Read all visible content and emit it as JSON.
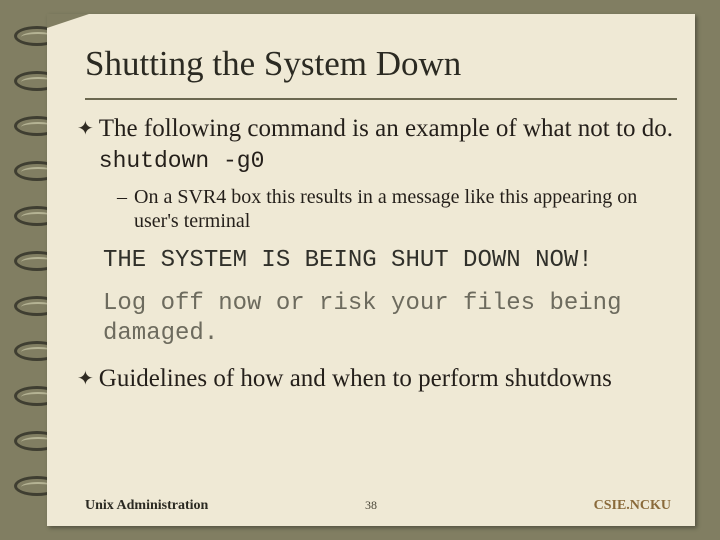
{
  "slide": {
    "title": "Shutting the System Down",
    "bullets": [
      {
        "level": 1,
        "text_before": "The following command is an example of what not to do. ",
        "mono_text": "shutdown -g0"
      },
      {
        "level": 2,
        "text": "On a SVR4 box this results in a message like this appearing on user's terminal"
      }
    ],
    "code_blocks": [
      {
        "text": "THE SYSTEM IS BEING SHUT DOWN NOW!",
        "style": "dark"
      },
      {
        "text": "Log off now or risk your files being damaged.",
        "style": "gray"
      }
    ],
    "final_bullet": {
      "level": 1,
      "text": "Guidelines of how and when to perform shutdowns"
    }
  },
  "footer": {
    "left": "Unix Administration",
    "page_number": "38",
    "right": "CSIE.NCKU"
  },
  "icons": {
    "bullet_level1": "✦",
    "bullet_level2": "–"
  },
  "colors": {
    "page_background": "#efe9d5",
    "frame": "#817e62",
    "title_text": "#2b2a22",
    "code_gray": "#6d6b5e",
    "footer_right": "#8a6a3a"
  }
}
